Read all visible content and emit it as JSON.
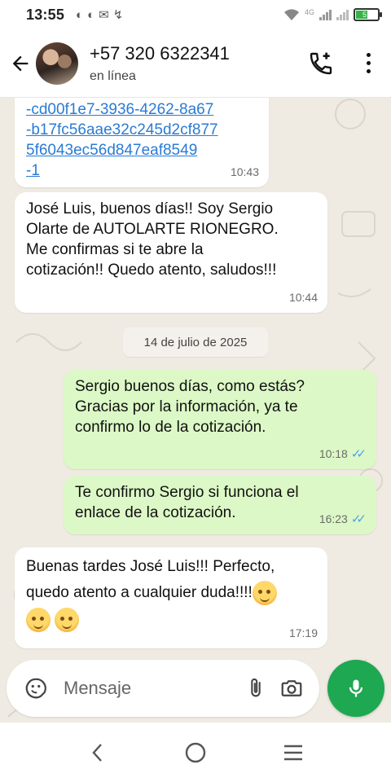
{
  "status_bar": {
    "time": "13:55",
    "network_label": "4G",
    "battery_percent": "51",
    "battery_level": 0.51,
    "notification_icons": [
      "whatsapp-icon",
      "whatsapp-icon",
      "gmail-icon",
      "missed-call-icon"
    ]
  },
  "header": {
    "contact_name": "+57 320 6322341",
    "contact_status": "en línea"
  },
  "messages": [
    {
      "direction": "in",
      "text": "-cd00f1e7-3936-4262-8a67\n-b17fc56aae32c245d2cf877\n5f6043ec56d847eaf8549\n-1",
      "time": "10:43",
      "is_link": true
    },
    {
      "direction": "in",
      "text": "José Luis, buenos días!! Soy Sergio\nOlarte de AUTOLARTE RIONEGRO.\nMe confirmas si te abre la\ncotización!! Quedo atento, saludos!!!",
      "time": "10:44"
    },
    {
      "direction": "out",
      "text": "Sergio buenos días, como estás?\nGracias por la información, ya te\nconfirmo lo de la cotización.",
      "time": "10:18",
      "status": "read"
    },
    {
      "direction": "out",
      "text": "Te confirmo Sergio si funciona el\nenlace de la cotización.",
      "time": "16:23",
      "status": "read"
    },
    {
      "direction": "in",
      "text": "Buenas tardes José Luis!!! Perfecto,\nquedo atento a cualquier duda!!!!",
      "time": "17:19",
      "emoji_count": 3
    }
  ],
  "date_separator": "14 de julio de 2025",
  "composer": {
    "placeholder": "Mensaje"
  },
  "colors": {
    "chat_background": "#efeae2",
    "outgoing_bubble": "#dcf8c6",
    "incoming_bubble": "#ffffff",
    "read_ticks": "#4fa3e6",
    "mic_button": "#1da851",
    "link": "#2a7bd4"
  }
}
